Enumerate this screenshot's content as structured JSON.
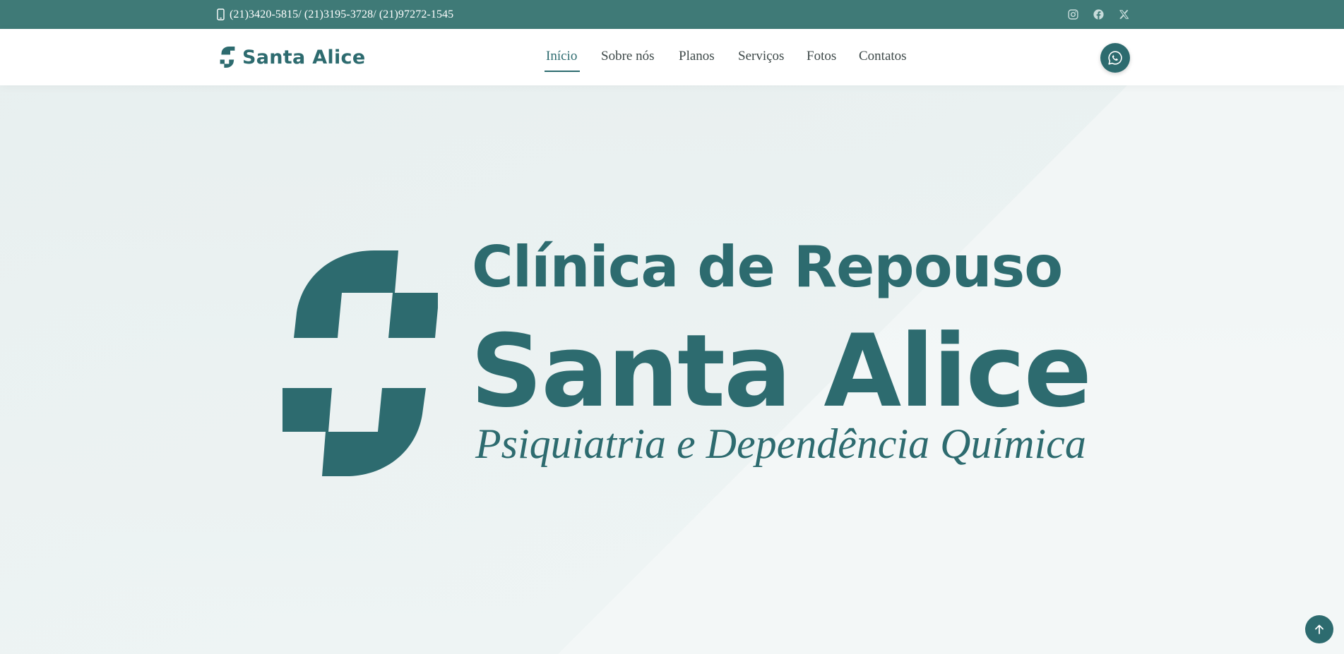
{
  "topbar": {
    "phone": "(21)3420-5815/ (21)3195-3728/ (21)97272-1545",
    "social": [
      "instagram-icon",
      "facebook-icon",
      "x-twitter-icon"
    ]
  },
  "header": {
    "brand": "Santa Alice",
    "nav": [
      {
        "label": "Início",
        "active": true
      },
      {
        "label": "Sobre nós",
        "active": false
      },
      {
        "label": "Planos",
        "active": false
      },
      {
        "label": "Serviços",
        "active": false
      },
      {
        "label": "Fotos",
        "active": false
      },
      {
        "label": "Contatos",
        "active": false
      }
    ],
    "whatsapp_icon": "whatsapp-icon"
  },
  "hero": {
    "title": "Clínica de Repouso",
    "name": "Santa Alice",
    "subtitle": "Psiquiatria e Dependência Química"
  },
  "colors": {
    "brand": "#2d6b6f",
    "topbar": "#3f7a77",
    "hero_bg": "#eef3f3"
  },
  "back_to_top_icon": "arrow-up-icon"
}
